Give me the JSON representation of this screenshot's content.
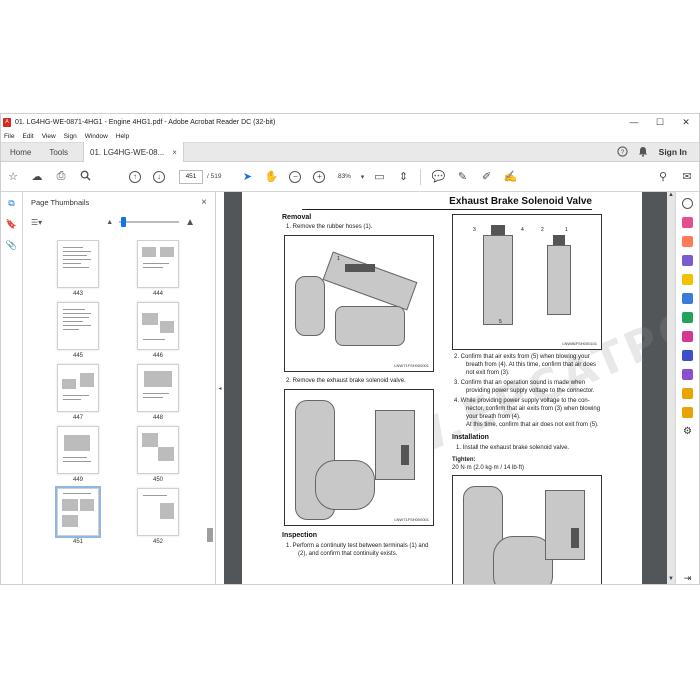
{
  "window": {
    "title": "01. LG4HG-WE-0871-4HG1 - Engine 4HG1.pdf - Adobe Acrobat Reader DC (32-bit)",
    "controls": [
      "—",
      "☐",
      "✕"
    ]
  },
  "menu": [
    "File",
    "Edit",
    "View",
    "Sign",
    "Window",
    "Help"
  ],
  "tabs": {
    "home": "Home",
    "tools": "Tools",
    "doc": "01. LG4HG-WE-08...",
    "close": "×",
    "help": "?",
    "bell": "🔔",
    "signin": "Sign In"
  },
  "toolbar": {
    "page_current": "451",
    "page_total": "/ 519",
    "zoom": "83%"
  },
  "thumbnails": {
    "title": "Page Thumbnails",
    "close": "×",
    "pages": [
      "443",
      "444",
      "445",
      "446",
      "447",
      "448",
      "449",
      "450",
      "451",
      "452"
    ],
    "selected": "451"
  },
  "document": {
    "title": "Exhaust Brake Solenoid Valve",
    "watermark": "WWW.EPCATPC.COM",
    "removal": {
      "heading": "Removal",
      "step1": "1.   Remove the rubber hoses (1).",
      "step2": "2.   Remove the exhaust brake solenoid valve."
    },
    "inspection": {
      "heading": "Inspection",
      "step1a": "1.   Perform a continuity test between terminals (1) and",
      "step1b": "(2), and confirm that continuity exists."
    },
    "right_steps": {
      "s2a": "2.   Confirm that air exits from (5) when blowing your",
      "s2b": "breath from (4). At this time, confirm that air does",
      "s2c": "not exit from (3).",
      "s3a": "3.   Confirm that an operation sound is made when",
      "s3b": "providing power supply voltage to the connector.",
      "s4a": "4.   While providing power supply voltage to the con-",
      "s4b": "nector, confirm that air exits from (3) when blowing",
      "s4c": "your breath from (4).",
      "s4d": "At this time, confirm that air does not exit from (5)."
    },
    "installation": {
      "heading": "Installation",
      "step1": "1.   Install the exhaust brake solenoid valve.",
      "tighten_label": "Tighten:",
      "tighten_value": "20 N·m (2.0 kg·m / 14 lb·ft)"
    },
    "captions": {
      "fig1": "LNW71FSH000001",
      "fig2": "LNW71FSH000001",
      "fig3": "LNW86FSH000101"
    },
    "callouts": {
      "fig1": "1",
      "fig3_1": "1",
      "fig3_2": "2",
      "fig3_3": "3",
      "fig3_4": "4",
      "fig3_5": "5"
    }
  }
}
